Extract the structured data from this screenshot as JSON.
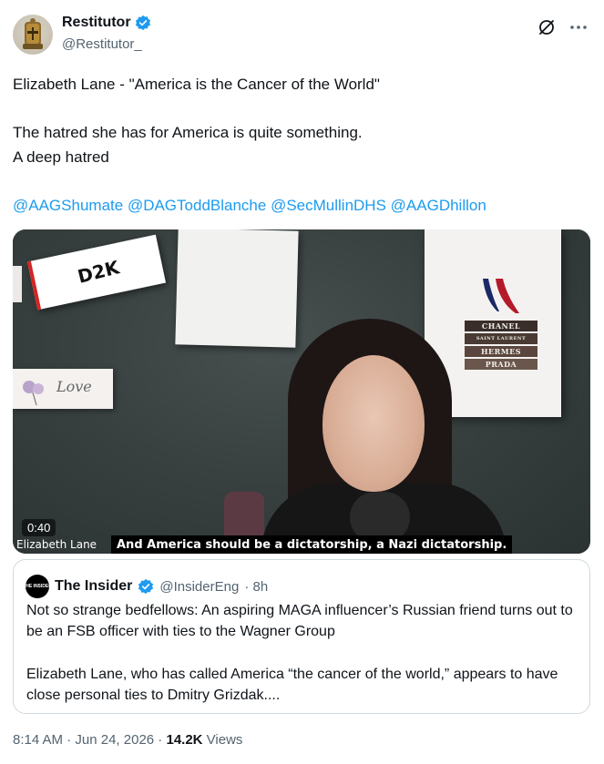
{
  "author": {
    "display_name": "Restitutor",
    "handle": "@Restitutor_",
    "avatar_icon": "knight-helmet-icon"
  },
  "tweet": {
    "line1": "Elizabeth Lane - \"America is the Cancer of the World\"",
    "line2": "The hatred she has for America is quite something.",
    "line3": "A deep hatred",
    "mentions": [
      "@AAGShumate",
      "@DAGToddBlanche",
      "@SecMullinDHS",
      "@AAGDhillon"
    ]
  },
  "media": {
    "d2k_label": "D2K",
    "love_label": "Love",
    "book_labels": [
      "CHANEL",
      "SAINT LAURENT",
      "HERMES",
      "PRADA"
    ],
    "timestamp": "0:40",
    "speaker_name": "Elizabeth Lane",
    "caption": "And America should be a dictatorship, a Nazi dictatorship."
  },
  "quoted": {
    "avatar_text": "THE INSIDER",
    "name": "The Insider",
    "handle": "@InsiderEng",
    "time": "· 8h",
    "para1": "Not so strange bedfellows: An aspiring MAGA influencer’s Russian friend turns out to be an FSB officer with ties to the Wagner Group",
    "para2": "Elizabeth Lane, who has called America “the cancer of the world,” appears to have close personal ties to Dmitry Grizdak...."
  },
  "meta": {
    "time": "8:14 AM",
    "sep1": " · ",
    "date": "Jun 24, 2026",
    "sep2": " · ",
    "views_count": "14.2K",
    "views_label": " Views"
  },
  "colors": {
    "link": "#1d9bf0",
    "verified": "#1d9bf0",
    "muted": "#536471",
    "text": "#0f1419"
  }
}
